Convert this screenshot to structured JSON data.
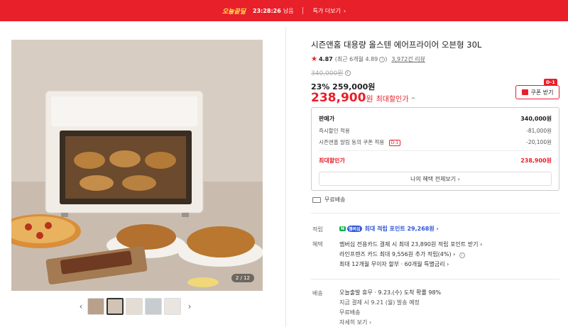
{
  "banner": {
    "logo": "오늘끝딜",
    "timer": "23:28:26",
    "timer_suffix": "남음",
    "more_label": "특가 더보기",
    "more_chevron": "›"
  },
  "gallery": {
    "counter": "2 / 12",
    "prev": "‹",
    "next": "›",
    "thumb_count": 5,
    "active_index": 1
  },
  "product": {
    "title": "시즌앤홈 대용량 올스텐 에어프라이어 오븐형 30L",
    "rating_star": "★",
    "rating": "4.87",
    "rating_recent": "(최근 6개월 4.89",
    "rating_recent_close": ")",
    "reviews": "3,972건 리뷰",
    "original_price": "340,000원",
    "sale_line": "23% 259,000원",
    "final_amount": "238,900",
    "final_won": "원",
    "final_label": "최대할인가",
    "final_chevron": "^",
    "coupon_label": "쿠폰 받기",
    "coupon_tag": "D-1",
    "info_glyph": "i"
  },
  "price_box": {
    "rows": [
      {
        "label": "판매가",
        "value": "340,000원"
      },
      {
        "label": "즉시할인 적용",
        "value": "-81,000원"
      },
      {
        "label": "시즌앤홈 알림 동의 쿠폰 적용",
        "tag": "D-1",
        "value": "-20,100원"
      },
      {
        "label": "최대할인가",
        "value": "238,900원"
      }
    ],
    "benefits_button": "나의 혜택 전체보기 ›"
  },
  "shipping": {
    "free_label": "무료배송"
  },
  "details": {
    "points_label": "적립",
    "points_badge_npay": "N",
    "points_badge_member": "멤버십",
    "points_text": "최대 적립 포인트 29,268원 ›",
    "benefit_label": "혜택",
    "benefit_lines": [
      "멤버십 전용카드 결제 시 최대 23,890원 적립 포인트 받기 ›",
      "라인프렌즈 카드 최대 9,556원 추가 적립(4%) ›",
      "최대 12개월 무이자 할부 · 60개월 특별금리 ›"
    ],
    "delivery_label": "배송",
    "delivery_lines": [
      "오늘출발 휴무 · 9.23.(수) 도착 확률 98%",
      "지금 결제 시 9.21 (월) 발송 예정",
      "무료배송",
      "자세히 보기 ›"
    ]
  },
  "colors": {
    "accent": "#e8202a",
    "points_blue": "#2e56d6",
    "npay_green": "#10b04a"
  }
}
